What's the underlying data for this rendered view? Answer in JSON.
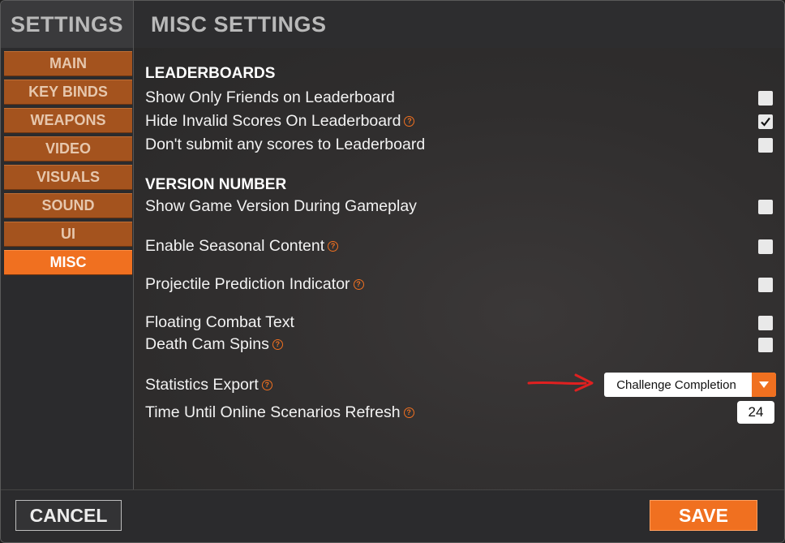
{
  "sidebar": {
    "title": "SETTINGS",
    "items": [
      {
        "label": "MAIN"
      },
      {
        "label": "KEY BINDS"
      },
      {
        "label": "WEAPONS"
      },
      {
        "label": "VIDEO"
      },
      {
        "label": "VISUALS"
      },
      {
        "label": "SOUND"
      },
      {
        "label": "UI"
      },
      {
        "label": "MISC",
        "active": true
      }
    ]
  },
  "main": {
    "title": "MISC SETTINGS",
    "leaderboards": {
      "heading": "LEADERBOARDS",
      "show_friends_only": {
        "label": "Show Only Friends on Leaderboard",
        "checked": false
      },
      "hide_invalid_scores": {
        "label": "Hide Invalid Scores On Leaderboard",
        "checked": true
      },
      "dont_submit_scores": {
        "label": "Don't submit any scores to Leaderboard",
        "checked": false
      }
    },
    "version_number": {
      "heading": "VERSION NUMBER",
      "show_game_version": {
        "label": "Show Game Version During Gameplay",
        "checked": false
      }
    },
    "seasonal_content": {
      "label": "Enable Seasonal Content",
      "checked": false
    },
    "projectile_prediction": {
      "label": "Projectile Prediction Indicator",
      "checked": false
    },
    "floating_combat_text": {
      "label": "Floating Combat Text",
      "checked": false
    },
    "death_cam_spins": {
      "label": "Death Cam Spins",
      "checked": false
    },
    "statistics_export": {
      "label": "Statistics Export",
      "value": "Challenge Completion"
    },
    "online_scenarios_refresh": {
      "label": "Time Until Online Scenarios Refresh",
      "value": "24"
    }
  },
  "footer": {
    "cancel_label": "CANCEL",
    "save_label": "SAVE"
  },
  "icons": {
    "help": "help-icon",
    "check": "checkmark-icon",
    "dropdown": "triangle-down-icon",
    "annotation": "red-arrow-icon"
  },
  "colors": {
    "accent": "#f07020",
    "nav_inactive": "#a4531e",
    "annotation": "#e02020"
  }
}
